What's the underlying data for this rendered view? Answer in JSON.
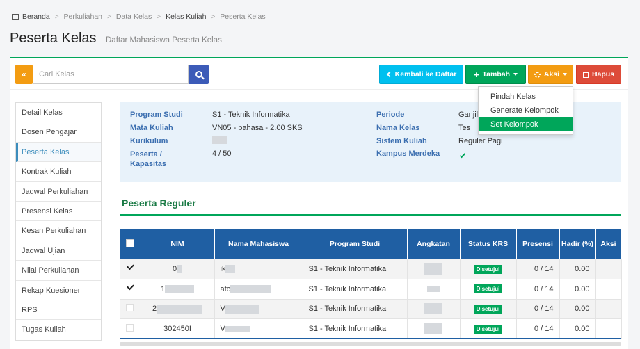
{
  "breadcrumb": [
    "Beranda",
    "Perkuliahan",
    "Data Kelas",
    "Kelas Kuliah",
    "Peserta Kelas"
  ],
  "header": {
    "title": "Peserta Kelas",
    "subtitle": "Daftar Mahasiswa Peserta Kelas"
  },
  "toolbar": {
    "collapse_label": "«",
    "search_placeholder": "Cari Kelas",
    "back_label": "Kembali ke Daftar",
    "tambah_label": "Tambah",
    "aksi_label": "Aksi",
    "hapus_label": "Hapus"
  },
  "aksi_menu": [
    "Pindah Kelas",
    "Generate Kelompok",
    "Set Kelompok"
  ],
  "sidebar": {
    "items": [
      "Detail Kelas",
      "Dosen Pengajar",
      "Peserta Kelas",
      "Kontrak Kuliah",
      "Jadwal Perkuliahan",
      "Presensi Kelas",
      "Kesan Perkuliahan",
      "Jadwal Ujian",
      "Nilai Perkuliahan",
      "Rekap Kuesioner",
      "RPS",
      "Tugas Kuliah"
    ],
    "active_index": 2
  },
  "info": {
    "program_studi_label": "Program Studi",
    "program_studi": "S1 - Teknik Informatika",
    "mata_kuliah_label": "Mata Kuliah",
    "mata_kuliah": "VN05 - bahasa - 2.00 SKS",
    "kurikulum_label": "Kurikulum",
    "peserta_label": "Peserta / Kapasitas",
    "peserta": "4 / 50",
    "periode_label": "Periode",
    "periode": "Ganjil",
    "nama_kelas_label": "Nama Kelas",
    "nama_kelas": "Tes",
    "sistem_kuliah_label": "Sistem Kuliah",
    "sistem_kuliah": "Reguler Pagi",
    "kampus_merdeka_label": "Kampus Merdeka"
  },
  "section_title": "Peserta Reguler",
  "table": {
    "headers": [
      "NIM",
      "Nama Mahasiswa",
      "Program Studi",
      "Angkatan",
      "Status KRS",
      "Presensi",
      "Hadir (%)",
      "Aksi"
    ],
    "rows": [
      {
        "checked": true,
        "nim": "0",
        "nama": "ik",
        "prodi": "S1 - Teknik Informatika",
        "status": "Disetujui",
        "presensi": "0 / 14",
        "hadir": "0.00"
      },
      {
        "checked": true,
        "nim": "1",
        "nama": "afc",
        "prodi": "S1 - Teknik Informatika",
        "status": "Disetujui",
        "presensi": "0 / 14",
        "hadir": "0.00"
      },
      {
        "checked": false,
        "nim": "2",
        "nama": "V",
        "prodi": "S1 - Teknik Informatika",
        "status": "Disetujui",
        "presensi": "0 / 14",
        "hadir": "0.00"
      },
      {
        "checked": false,
        "nim": "302450I",
        "nama": "V",
        "prodi": "S1 - Teknik Informatika",
        "status": "Disetujui",
        "presensi": "0 / 14",
        "hadir": "0.00"
      }
    ]
  },
  "colors": {
    "primary": "#1f5fa3",
    "success": "#00a65a",
    "warning": "#f39c12",
    "danger": "#dd4b39",
    "info": "#00c0ef"
  }
}
